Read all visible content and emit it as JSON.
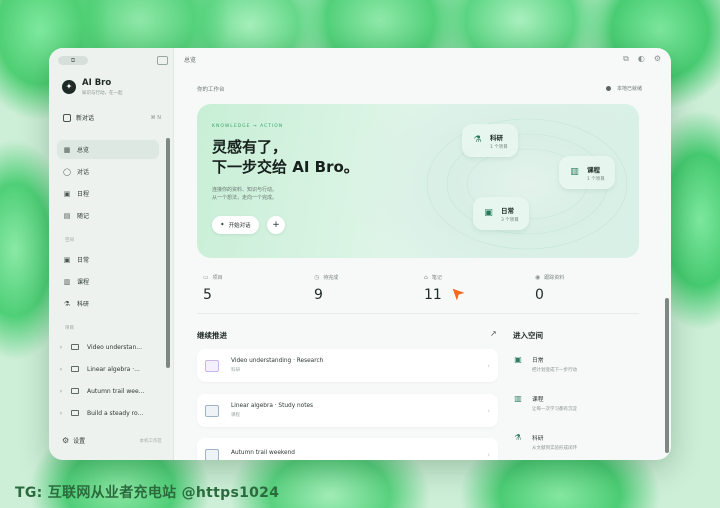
{
  "window": {
    "traffic_label": "⧉"
  },
  "sidebar": {
    "brand": {
      "name": "AI Bro",
      "subtitle": "知识与行动，在一起"
    },
    "new_chat": {
      "label": "新对话",
      "shortcut": "⌘ N"
    },
    "nav": [
      {
        "label": "总览",
        "icon": "grid-icon",
        "glyph": "▦",
        "active": true
      },
      {
        "label": "对话",
        "icon": "chat-icon",
        "glyph": "◯",
        "active": false
      },
      {
        "label": "日程",
        "icon": "calendar-icon",
        "glyph": "▣",
        "active": false
      },
      {
        "label": "随记",
        "icon": "note-icon",
        "glyph": "▤",
        "active": false
      }
    ],
    "section_spaces": "空间",
    "spaces": [
      {
        "label": "日常",
        "icon": "calendar-icon",
        "glyph": "▣"
      },
      {
        "label": "课程",
        "icon": "chart-icon",
        "glyph": "▥"
      },
      {
        "label": "科研",
        "icon": "flask-icon",
        "glyph": "⚗"
      }
    ],
    "section_projects": "项目",
    "projects": [
      {
        "label": "Video understan..."
      },
      {
        "label": "Linear algebra ·..."
      },
      {
        "label": "Autumn trail wee..."
      },
      {
        "label": "Build a steady ro..."
      }
    ],
    "settings": {
      "label": "设置",
      "right": "本机工作区"
    }
  },
  "topbar": {
    "title": "总览"
  },
  "header": {
    "workspace": "你的工作台",
    "status": "本地已就绪"
  },
  "hero": {
    "tag": "KNOWLEDGE → ACTION",
    "title_line1": "灵感有了，",
    "title_line2": "下一步交给 AI Bro。",
    "desc_line1": "连接你的资料、知识与行动。",
    "desc_line2": "从一个想法，走向一个完成。",
    "start_button": "开始对话",
    "plus_button": "+",
    "chips": [
      {
        "name": "科研",
        "count": "1 个项目",
        "icon": "flask-icon",
        "glyph": "⚗"
      },
      {
        "name": "课程",
        "count": "1 个项目",
        "icon": "chart-icon",
        "glyph": "▥"
      },
      {
        "name": "日常",
        "count": "3 个项目",
        "icon": "calendar-icon",
        "glyph": "▣"
      }
    ]
  },
  "stats": [
    {
      "label": "项目",
      "value": "5",
      "icon": "folder-icon",
      "glyph": "▭"
    },
    {
      "label": "待完成",
      "value": "9",
      "icon": "clock-icon",
      "glyph": "◷"
    },
    {
      "label": "笔记",
      "value": "11",
      "icon": "home-icon",
      "glyph": "⌂"
    },
    {
      "label": "跟踪资料",
      "value": "0",
      "icon": "eye-icon",
      "glyph": "◉"
    }
  ],
  "continue": {
    "heading": "继续推进",
    "arrow": "↗",
    "cards": [
      {
        "title": "Video understanding · Research",
        "sub": "科研",
        "color": "#c9b6ee"
      },
      {
        "title": "Linear algebra · Study notes",
        "sub": "课程",
        "color": "#b7cbe2"
      },
      {
        "title": "Autumn trail weekend",
        "sub": "",
        "color": "#b7cbe2"
      }
    ]
  },
  "spaces_panel": {
    "heading": "进入空间",
    "items": [
      {
        "name": "日常",
        "sub": "把计划变成下一步行动",
        "icon": "calendar-icon",
        "glyph": "▣"
      },
      {
        "name": "课程",
        "sub": "让每一次学习都有沉淀",
        "icon": "chart-icon",
        "glyph": "▥"
      },
      {
        "name": "科研",
        "sub": "从文献到实验形成闭环",
        "icon": "flask-icon",
        "glyph": "⚗"
      }
    ]
  },
  "watermark": "TG: 互联网从业者充电站 @https1024",
  "colors": {
    "accent": "#2d7f61",
    "cursor": "#f26a21"
  }
}
